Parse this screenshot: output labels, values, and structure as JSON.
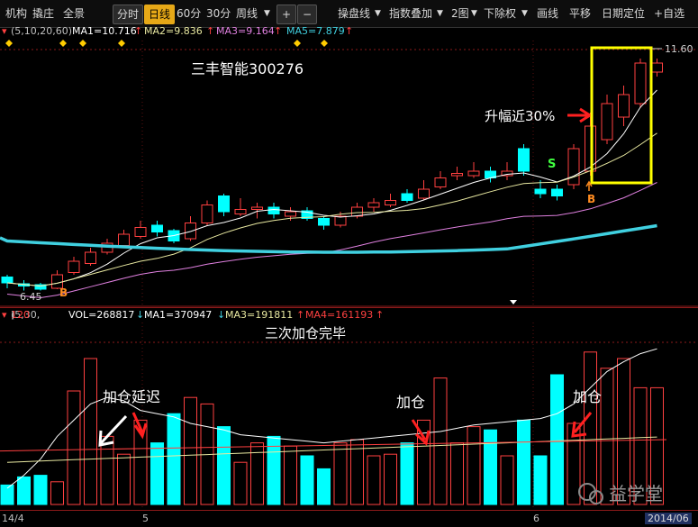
{
  "toolbar": {
    "left_items": [
      "机构",
      "撬庄",
      "全景"
    ],
    "period_buttons": [
      "分时",
      "日线",
      "60分",
      "30分",
      "周线"
    ],
    "active_period": "日线",
    "plus": "+",
    "minus": "−",
    "right_items": [
      "操盘线",
      "指数叠加",
      "2图",
      "下除权",
      "画线",
      "平移",
      "日期定位",
      "自选"
    ]
  },
  "price_indicator": {
    "params": "(5,10,20,60)",
    "ma1": "MA1=10.716",
    "ma2": "MA2=9.836",
    "ma3": "MA3=9.164",
    "ma5": "MA5=7.879",
    "up_arrow": "↑"
  },
  "volume_indicator": {
    "params_prefix": "(5,30,",
    "params_red": "120",
    "params_suffix": ")",
    "vol": "VOL=268817",
    "ma1": "MA1=370947",
    "ma3": "MA3=191811",
    "ma4": "MA4=161193",
    "down_arrow": "↓",
    "up_arrow": "↑"
  },
  "annotations": {
    "stock_title": "三丰智能300276",
    "rise_label": "升幅近30%",
    "volume_title": "三次加仓完毕",
    "delay_label": "加仓延迟",
    "add1_label": "加仓",
    "add2_label": "加仓",
    "sell_marker": "S",
    "buy_marker_left": "B",
    "buy_marker_right": "B",
    "high_price": "11.60",
    "low_price": "6.45",
    "watermark": "益学堂"
  },
  "bottom_axis": {
    "start_label": "14/4",
    "month5": "5",
    "month6": "6",
    "end_label": "2014/06"
  },
  "colors": {
    "up": "#ff4040",
    "down": "#00ffff",
    "ma5": "#ffffff",
    "ma10": "#e8e8a0",
    "ma20": "#e080e0",
    "ma60": "#40d0e0",
    "highlight_box": "#ffff00",
    "active_button": "#e6a817"
  },
  "chart_data": {
    "type": "candlestick",
    "price_range": [
      6.2,
      11.8
    ],
    "candles": [
      {
        "o": 6.75,
        "c": 6.62,
        "h": 6.8,
        "l": 6.5
      },
      {
        "o": 6.6,
        "c": 6.55,
        "h": 6.68,
        "l": 6.45
      },
      {
        "o": 6.58,
        "c": 6.48,
        "h": 6.62,
        "l": 6.45
      },
      {
        "o": 6.5,
        "c": 6.8,
        "h": 6.9,
        "l": 6.48
      },
      {
        "o": 6.85,
        "c": 7.1,
        "h": 7.2,
        "l": 6.8
      },
      {
        "o": 7.05,
        "c": 7.3,
        "h": 7.4,
        "l": 7.0
      },
      {
        "o": 7.3,
        "c": 7.5,
        "h": 7.6,
        "l": 7.25
      },
      {
        "o": 7.45,
        "c": 7.7,
        "h": 7.8,
        "l": 7.4
      },
      {
        "o": 7.65,
        "c": 7.85,
        "h": 8.0,
        "l": 7.6
      },
      {
        "o": 7.9,
        "c": 7.75,
        "h": 8.0,
        "l": 7.65
      },
      {
        "o": 7.78,
        "c": 7.55,
        "h": 7.82,
        "l": 7.5
      },
      {
        "o": 7.6,
        "c": 7.95,
        "h": 8.1,
        "l": 7.55
      },
      {
        "o": 7.95,
        "c": 8.35,
        "h": 8.45,
        "l": 7.9
      },
      {
        "o": 8.55,
        "c": 8.2,
        "h": 8.6,
        "l": 8.1
      },
      {
        "o": 8.15,
        "c": 8.25,
        "h": 8.5,
        "l": 8.1
      },
      {
        "o": 8.25,
        "c": 8.3,
        "h": 8.4,
        "l": 8.05
      },
      {
        "o": 8.3,
        "c": 8.15,
        "h": 8.4,
        "l": 8.05
      },
      {
        "o": 8.1,
        "c": 8.2,
        "h": 8.3,
        "l": 8.0
      },
      {
        "o": 8.22,
        "c": 8.05,
        "h": 8.3,
        "l": 8.0
      },
      {
        "o": 8.05,
        "c": 7.9,
        "h": 8.1,
        "l": 7.8
      },
      {
        "o": 7.9,
        "c": 8.1,
        "h": 8.2,
        "l": 7.85
      },
      {
        "o": 8.1,
        "c": 8.3,
        "h": 8.4,
        "l": 8.05
      },
      {
        "o": 8.3,
        "c": 8.4,
        "h": 8.5,
        "l": 8.2
      },
      {
        "o": 8.35,
        "c": 8.45,
        "h": 8.6,
        "l": 8.3
      },
      {
        "o": 8.6,
        "c": 8.45,
        "h": 8.7,
        "l": 8.4
      },
      {
        "o": 8.5,
        "c": 8.7,
        "h": 8.9,
        "l": 8.45
      },
      {
        "o": 8.75,
        "c": 8.95,
        "h": 9.1,
        "l": 8.7
      },
      {
        "o": 9.0,
        "c": 9.05,
        "h": 9.2,
        "l": 8.9
      },
      {
        "o": 9.0,
        "c": 9.1,
        "h": 9.3,
        "l": 8.95
      },
      {
        "o": 9.1,
        "c": 8.95,
        "h": 9.2,
        "l": 8.85
      },
      {
        "o": 9.0,
        "c": 9.1,
        "h": 9.3,
        "l": 8.9
      },
      {
        "o": 9.6,
        "c": 9.1,
        "h": 9.7,
        "l": 9.0
      },
      {
        "o": 8.7,
        "c": 8.6,
        "h": 8.9,
        "l": 8.5
      },
      {
        "o": 8.7,
        "c": 8.55,
        "h": 8.8,
        "l": 8.45
      },
      {
        "o": 8.8,
        "c": 9.6,
        "h": 9.7,
        "l": 8.7
      },
      {
        "o": 9.1,
        "c": 10.1,
        "h": 10.4,
        "l": 9.0
      },
      {
        "o": 9.8,
        "c": 10.6,
        "h": 10.8,
        "l": 9.7
      },
      {
        "o": 10.3,
        "c": 10.8,
        "h": 11.0,
        "l": 10.1
      },
      {
        "o": 10.6,
        "c": 11.5,
        "h": 11.6,
        "l": 10.5
      },
      {
        "o": 11.3,
        "c": 11.5,
        "h": 11.6,
        "l": 11.2
      }
    ],
    "volume": [
      120,
      170,
      180,
      140,
      700,
      900,
      420,
      310,
      520,
      380,
      560,
      660,
      620,
      480,
      260,
      380,
      420,
      360,
      300,
      220,
      380,
      400,
      300,
      310,
      380,
      520,
      780,
      380,
      480,
      460,
      300,
      520,
      300,
      800,
      500,
      940,
      840,
      900,
      720,
      720
    ],
    "volume_ma": [
      100,
      180,
      280,
      420,
      520,
      620,
      660,
      640,
      580,
      560,
      540,
      500,
      480,
      460,
      430,
      420,
      410,
      400,
      390,
      380,
      390,
      400,
      410,
      420,
      430,
      440,
      450,
      470,
      490,
      500,
      510,
      520,
      530,
      560,
      620,
      720,
      820,
      880,
      930,
      960
    ]
  }
}
